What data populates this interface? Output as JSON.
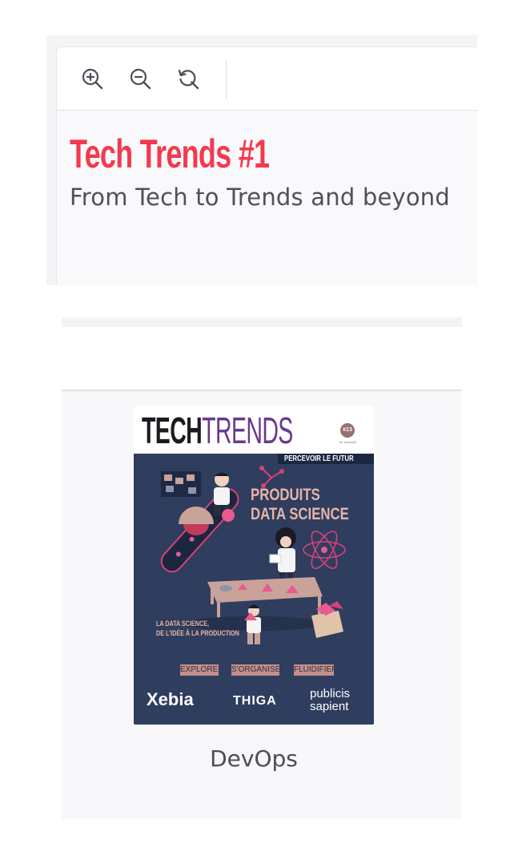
{
  "viewer": {
    "toolbar": {
      "zoom_in_icon": "zoom-in-icon",
      "zoom_out_icon": "zoom-out-icon",
      "reset_icon": "reset-zoom-icon"
    },
    "title": "Tech Trends #1",
    "subtitle": "From Tech to Trends and beyond",
    "title_color": "#f23a4f"
  },
  "card": {
    "cover": {
      "logo_part1": "TECH",
      "logo_part2": "TRENDS",
      "issue_number": "#13",
      "issue_date": "1er trimestre",
      "banner": "PERCEVOIR LE FUTUR",
      "headline_line1": "PRODUITS",
      "headline_line2": "DATA SCIENCE",
      "tagline_line1": "LA DATA SCIENCE,",
      "tagline_line2": "DE L'IDÉE À LA PRODUCTION",
      "pills": [
        "EXPLORER",
        "S'ORGANISER",
        "FLUIDIFIER"
      ],
      "partners": {
        "xebia": "Xebia",
        "thiga": "THIGA",
        "publicis_line1": "publicis",
        "publicis_line2": "sapient"
      }
    },
    "caption": "DevOps"
  }
}
